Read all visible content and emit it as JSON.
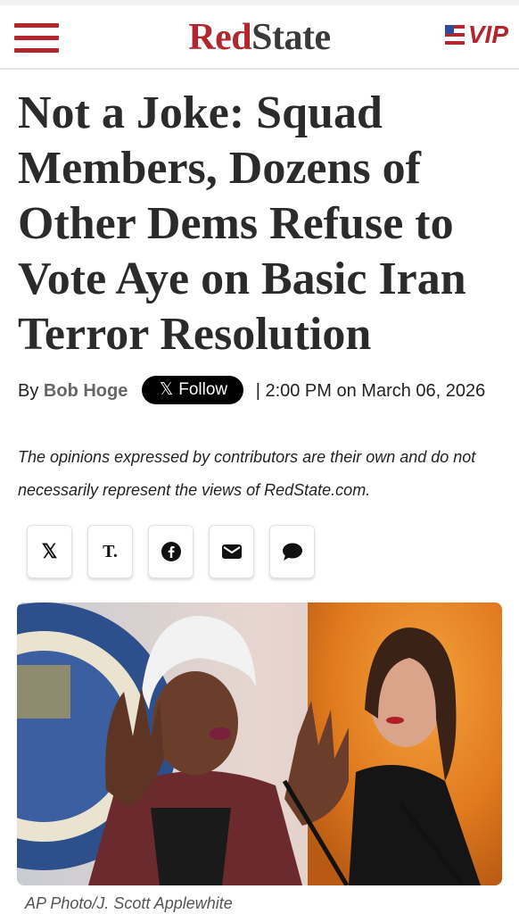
{
  "header": {
    "logo_red": "Red",
    "logo_dark": "State",
    "vip_label": "VIP"
  },
  "article": {
    "headline": "Not a Joke: Squad Members, Dozens of Other Dems Refuse to Vote Aye on Basic Iran Terror Resolution",
    "by_prefix": "By",
    "author": "Bob Hoge",
    "follow_icon": "𝕏",
    "follow_label": "Follow",
    "separator": "|",
    "timestamp": "2:00 PM on March 06, 2026",
    "disclaimer": "The opinions expressed by contributors are their own and do not necessarily represent the views of RedState.com.",
    "photo_caption": "AP Photo/J. Scott Applewhite"
  },
  "share": [
    {
      "icon": "x-icon",
      "glyph": "𝕏"
    },
    {
      "icon": "townhall-icon",
      "glyph": "T."
    },
    {
      "icon": "facebook-icon",
      "glyph": "f"
    },
    {
      "icon": "email-icon",
      "glyph": "✉"
    },
    {
      "icon": "comment-icon",
      "glyph": "💬"
    }
  ],
  "colors": {
    "brand_red": "#b3262d",
    "text_dark": "#2b2b2b"
  }
}
